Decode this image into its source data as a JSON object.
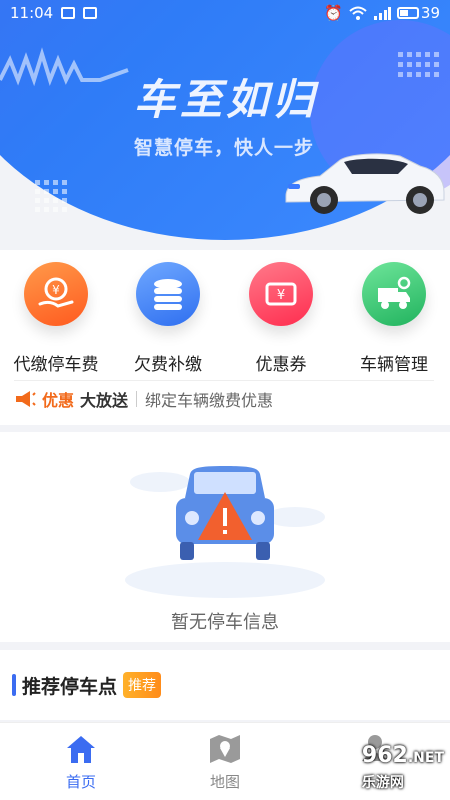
{
  "status_bar": {
    "time": "11:04",
    "battery": "39",
    "icons": [
      "notification-icon",
      "mail-icon",
      "alarm-icon",
      "wifi-icon",
      "signal-icon",
      "battery-icon"
    ]
  },
  "hero": {
    "title": "车至如归",
    "subtitle": "智慧停车，快人一步"
  },
  "menu": {
    "items": [
      {
        "label": "代缴停车费",
        "icon": "yen-coin-hand-icon",
        "color": "#ff6a2b"
      },
      {
        "label": "欠费补缴",
        "icon": "coin-stack-icon",
        "color": "#3f7cf5"
      },
      {
        "label": "优惠券",
        "icon": "coupon-icon",
        "color": "#ff3d5c"
      },
      {
        "label": "车辆管理",
        "icon": "truck-gear-icon",
        "color": "#2fc16b"
      }
    ]
  },
  "promo": {
    "tag_part1": "优惠",
    "tag_part2": "大放送",
    "text": "绑定车辆缴费优惠"
  },
  "empty_state": {
    "message": "暂无停车信息"
  },
  "recommend": {
    "title": "推荐停车点",
    "badge": "推荐"
  },
  "tabbar": {
    "tabs": [
      {
        "label": "首页",
        "icon": "home-icon",
        "active": true
      },
      {
        "label": "地图",
        "icon": "map-icon",
        "active": false
      }
    ],
    "accent": "#3b6cf1",
    "inactive": "#888888"
  },
  "watermark": {
    "brand": "962",
    "suffix": ".NET",
    "sub": "乐游网"
  }
}
